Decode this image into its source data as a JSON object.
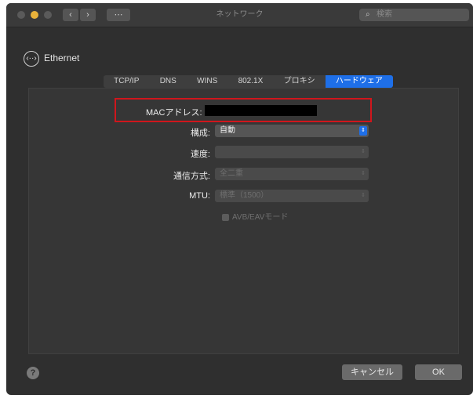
{
  "window": {
    "title": "ネットワーク",
    "search_placeholder": "検索",
    "nav_back": "‹",
    "nav_forward": "›",
    "grid": "⋯"
  },
  "interface": {
    "icon": "‹··›",
    "name": "Ethernet"
  },
  "tabs": [
    {
      "label": "TCP/IP",
      "active": false
    },
    {
      "label": "DNS",
      "active": false
    },
    {
      "label": "WINS",
      "active": false
    },
    {
      "label": "802.1X",
      "active": false
    },
    {
      "label": "プロキシ",
      "active": false
    },
    {
      "label": "ハードウェア",
      "active": true
    }
  ],
  "hardware": {
    "mac_label": "MACアドレス:",
    "mac_value": "",
    "config_label": "構成:",
    "config_value": "自動",
    "speed_label": "速度:",
    "speed_value": "",
    "duplex_label": "通信方式:",
    "duplex_value": "全二重",
    "mtu_label": "MTU:",
    "mtu_value": "標準（1500）",
    "avb_label": "AVB/EAVモード"
  },
  "footer": {
    "help": "?",
    "cancel": "キャンセル",
    "ok": "OK"
  },
  "colors": {
    "accent": "#1e6fe8",
    "highlight_border": "#d0161c",
    "minimize_light": "#e9b23a"
  }
}
